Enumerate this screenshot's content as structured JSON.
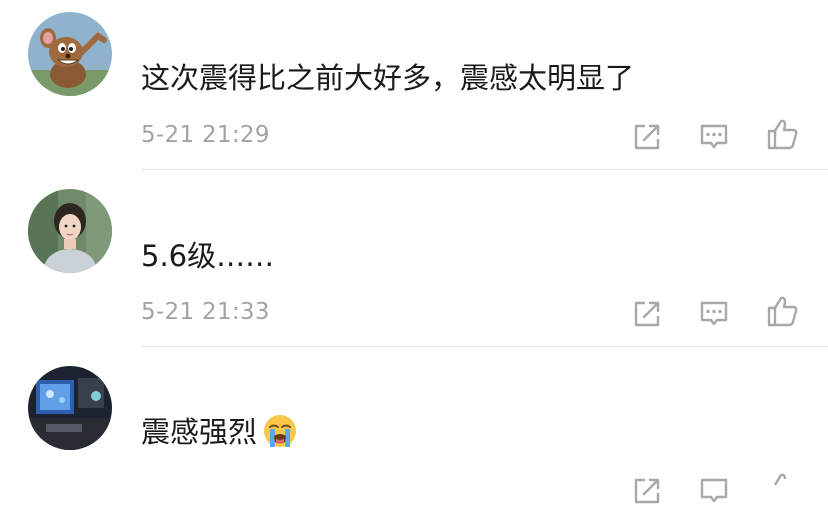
{
  "comments": [
    {
      "avatar_icon": "cartoon-mouse-avatar",
      "text": "这次震得比之前大好多，震感太明显了",
      "time": "5-21 21:29"
    },
    {
      "avatar_icon": "girl-photo-avatar",
      "text": "5.6级……",
      "time": "5-21 21:33"
    },
    {
      "avatar_icon": "dark-room-avatar",
      "text": "震感强烈",
      "emoji": "loudly-crying-emoji",
      "time": ""
    }
  ],
  "actions": {
    "share_icon": "share-icon",
    "reply_icon": "reply-comment-icon",
    "like_icon": "thumbs-up-icon"
  },
  "colors": {
    "text": "#1a1a1a",
    "meta": "#a3a3a3",
    "icon": "#a8a8a8",
    "divider": "#e5e5e5"
  }
}
